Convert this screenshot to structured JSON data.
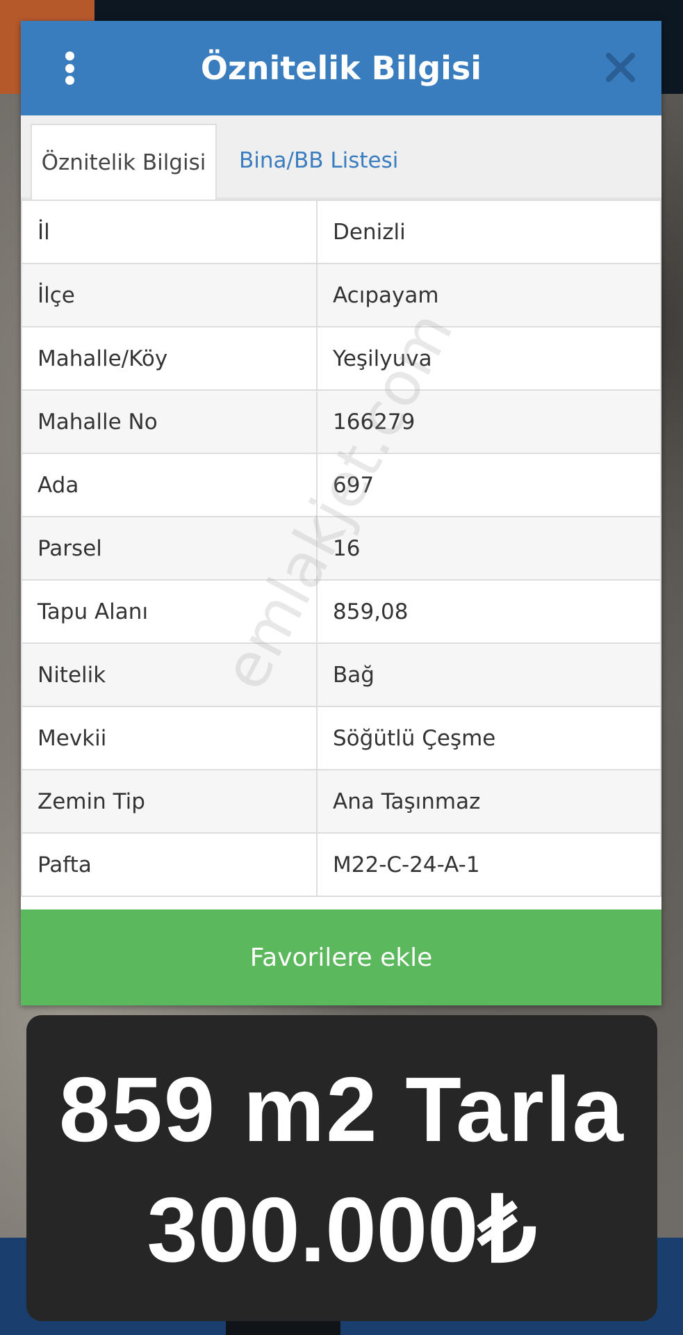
{
  "dialog": {
    "title": "Öznitelik Bilgisi",
    "tabs": [
      {
        "label": "Öznitelik Bilgisi",
        "active": true
      },
      {
        "label": "Bina/BB Listesi",
        "active": false
      }
    ],
    "rows": [
      {
        "key": "İl",
        "value": "Denizli"
      },
      {
        "key": "İlçe",
        "value": "Acıpayam"
      },
      {
        "key": "Mahalle/Köy",
        "value": "Yeşilyuva"
      },
      {
        "key": "Mahalle No",
        "value": "166279"
      },
      {
        "key": "Ada",
        "value": "697"
      },
      {
        "key": "Parsel",
        "value": "16"
      },
      {
        "key": "Tapu Alanı",
        "value": "859,08"
      },
      {
        "key": "Nitelik",
        "value": "Bağ"
      },
      {
        "key": "Mevkii",
        "value": "Söğütlü Çeşme"
      },
      {
        "key": "Zemin Tip",
        "value": "Ana Taşınmaz"
      },
      {
        "key": "Pafta",
        "value": "M22-C-24-A-1"
      }
    ],
    "favorite_button": "Favorilere ekle"
  },
  "watermark": "emlakjet.com",
  "banner": {
    "line1": "859 m2 Tarla",
    "line2": "300.000₺"
  },
  "colors": {
    "header": "#3a7dbf",
    "favorite_button": "#5cb85c",
    "tab_link": "#3a7dbf",
    "banner": "#262626"
  },
  "icons": {
    "menu": "vertical-dots-icon",
    "close": "close-icon"
  }
}
